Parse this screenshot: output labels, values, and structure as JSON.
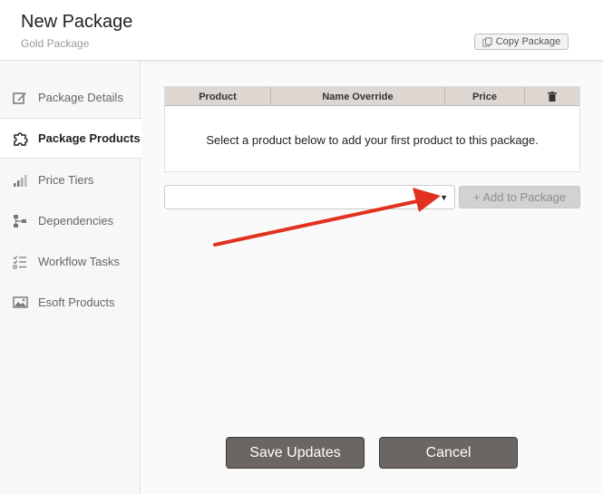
{
  "header": {
    "title": "New Package",
    "subtitle": "Gold Package",
    "copy_label": "Copy Package"
  },
  "sidebar": {
    "items": [
      {
        "label": "Package Details",
        "icon": "pencil-icon",
        "active": false
      },
      {
        "label": "Package Products",
        "icon": "puzzle-icon",
        "active": true
      },
      {
        "label": "Price Tiers",
        "icon": "bar-chart-icon",
        "active": false
      },
      {
        "label": "Dependencies",
        "icon": "hierarchy-icon",
        "active": false
      },
      {
        "label": "Workflow Tasks",
        "icon": "checklist-icon",
        "active": false
      },
      {
        "label": "Esoft Products",
        "icon": "image-icon",
        "active": false
      }
    ]
  },
  "products_table": {
    "columns": [
      "Product",
      "Name Override",
      "Price"
    ],
    "delete_column_icon": "trash-icon",
    "empty_message": "Select a product below to add your first product to this package."
  },
  "product_select": {
    "value": ""
  },
  "add_button": {
    "label": "+ Add to Package",
    "disabled": true
  },
  "footer": {
    "save_label": "Save Updates",
    "cancel_label": "Cancel"
  },
  "colors": {
    "annotation_arrow": "#e0321f",
    "dark_button": "#6b6661",
    "table_header": "#ddd6d1"
  }
}
